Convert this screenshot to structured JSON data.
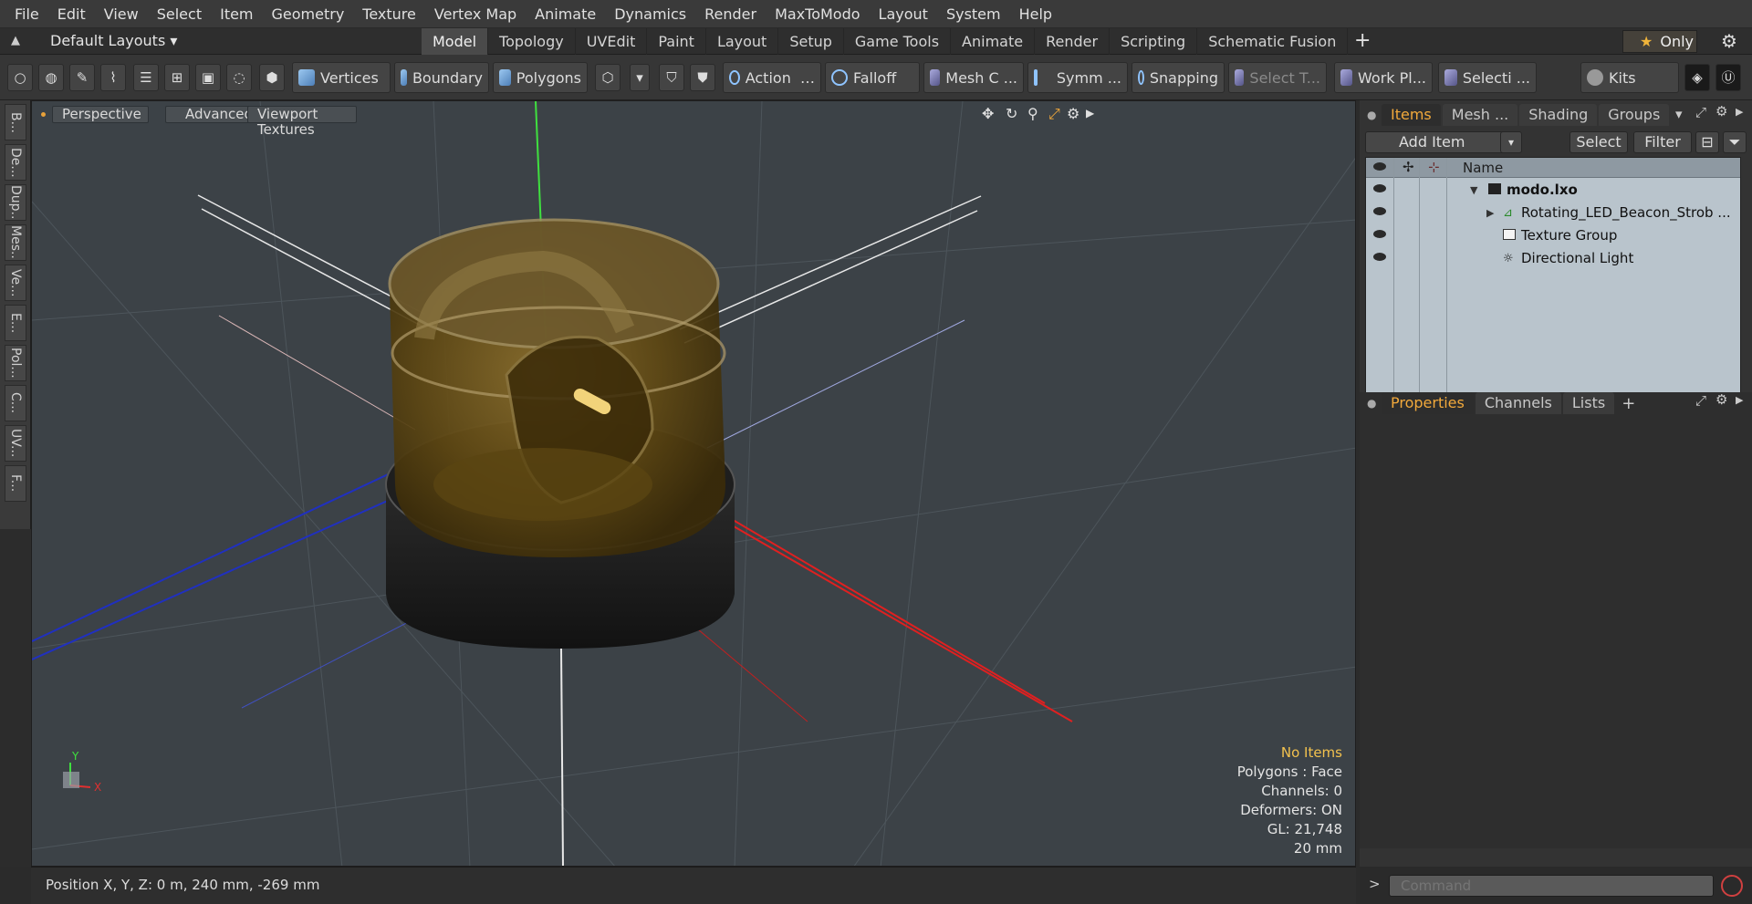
{
  "menu": [
    "File",
    "Edit",
    "View",
    "Select",
    "Item",
    "Geometry",
    "Texture",
    "Vertex Map",
    "Animate",
    "Dynamics",
    "Render",
    "MaxToModo",
    "Layout",
    "System",
    "Help"
  ],
  "layoutbar": {
    "layouts_label": "Default Layouts",
    "tabs": [
      "Model",
      "Topology",
      "UVEdit",
      "Paint",
      "Layout",
      "Setup",
      "Game Tools",
      "Animate",
      "Render",
      "Scripting",
      "Schematic Fusion"
    ],
    "active_tab": "Model",
    "only_label": "Only"
  },
  "toolbar": {
    "vertices": "Vertices",
    "boundary": "Boundary",
    "polygons": "Polygons",
    "action": "Action",
    "falloff": "Falloff",
    "mesh": "Mesh C ...",
    "symmetry": "Symm ...",
    "snapping": "Snapping",
    "select_t": "Select T...",
    "workplane": "Work Pl...",
    "selection": "Selecti ...",
    "kits": "Kits"
  },
  "lefttabs": [
    "B...",
    "De...",
    "Dup...",
    "Mes...",
    "Ve...",
    "E...",
    "Pol...",
    "C...",
    "UV...",
    "F..."
  ],
  "viewport": {
    "view_label": "Perspective",
    "advanced_label": "Advanced",
    "textures_label": "Viewport Textures",
    "info": {
      "selection": "No Items",
      "polygons": "Polygons : Face",
      "channels": "Channels: 0",
      "deformers": "Deformers: ON",
      "gl": "GL: 21,748",
      "grid": "20 mm"
    },
    "axis_x": "X",
    "axis_y": "Y"
  },
  "status": {
    "position": "Position X, Y, Z:   0 m, 240 mm, -269 mm"
  },
  "rightpanel": {
    "top_tabs": [
      "Items",
      "Mesh ...",
      "Shading",
      "Groups"
    ],
    "active_top_tab": "Items",
    "add_item": "Add Item",
    "select_btn": "Select",
    "filter_btn": "Filter",
    "name_header": "Name",
    "items": [
      {
        "name": "modo.lxo",
        "depth": 0,
        "bold": true
      },
      {
        "name": "Rotating_LED_Beacon_Strob ...",
        "depth": 1,
        "bold": false
      },
      {
        "name": "Texture Group",
        "depth": 1,
        "bold": false
      },
      {
        "name": "Directional Light",
        "depth": 1,
        "bold": false
      }
    ],
    "bottom_tabs": [
      "Properties",
      "Channels",
      "Lists"
    ],
    "active_bottom_tab": "Properties",
    "command_placeholder": "Command"
  }
}
